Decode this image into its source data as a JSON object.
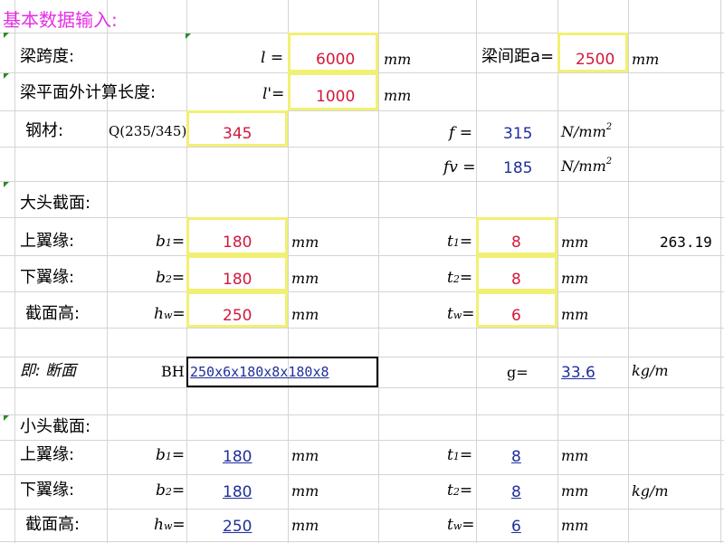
{
  "title": "基本数据输入:",
  "units": {
    "mm": "mm",
    "nmm2": "N/mm",
    "sq": "2",
    "kgm": "kg/m"
  },
  "rows": {
    "span": {
      "label": "梁跨度:",
      "sym": "l =",
      "value": "6000"
    },
    "spacing": {
      "label": "梁间距a=",
      "value": "2500"
    },
    "out_of_plane": {
      "label": "梁平面外计算长度:",
      "sym": "l'=",
      "value": "1000"
    },
    "steel": {
      "label": "钢材:",
      "grade": "Q(235/345)",
      "value": "345"
    },
    "f": {
      "sym": "f =",
      "value": "315"
    },
    "fv": {
      "sym": "fv =",
      "value": "185"
    }
  },
  "big_section": {
    "heading": "大头截面:",
    "top_flange": {
      "label": "上翼缘:",
      "b_sym": "b",
      "b_sub": "1",
      "b_eq": "=",
      "b_val": "180",
      "t_sym": "t",
      "t_sub": "1",
      "t_eq": "=",
      "t_val": "8",
      "extra": "263.19"
    },
    "bottom_flange": {
      "label": "下翼缘:",
      "b_sym": "b",
      "b_sub": "2",
      "b_eq": "=",
      "b_val": "180",
      "t_sym": "t",
      "t_sub": "2",
      "t_eq": "=",
      "t_val": "8"
    },
    "height": {
      "label": "截面高:",
      "h_sym": "h",
      "h_sub": "w",
      "h_eq": "=",
      "h_val": "250",
      "t_sym": "t",
      "t_sub": "w",
      "t_eq": "=",
      "t_val": "6"
    }
  },
  "section_result": {
    "label": "即:  断面",
    "prefix": "BH",
    "value": "250x6x180x8x180x8",
    "g_label": "g=",
    "g_value": "33.6",
    "g_unit": "kg/m"
  },
  "small_section": {
    "heading": "小头截面:",
    "top_flange": {
      "label": "上翼缘:",
      "b_sym": "b",
      "b_sub": "1",
      "b_eq": "=",
      "b_val": "180",
      "t_sym": "t",
      "t_sub": "1",
      "t_eq": "=",
      "t_val": "8"
    },
    "bottom_flange": {
      "label": "下翼缘:",
      "b_sym": "b",
      "b_sub": "2",
      "b_eq": "=",
      "b_val": "180",
      "t_sym": "t",
      "t_sub": "2",
      "t_eq": "=",
      "t_val": "8",
      "unit_extra": "kg/m"
    },
    "height": {
      "label": "截面高:",
      "h_sym": "h",
      "h_sub": "w",
      "h_eq": "=",
      "h_val": "250",
      "t_sym": "t",
      "t_sub": "w",
      "t_eq": "=",
      "t_val": "6"
    }
  }
}
